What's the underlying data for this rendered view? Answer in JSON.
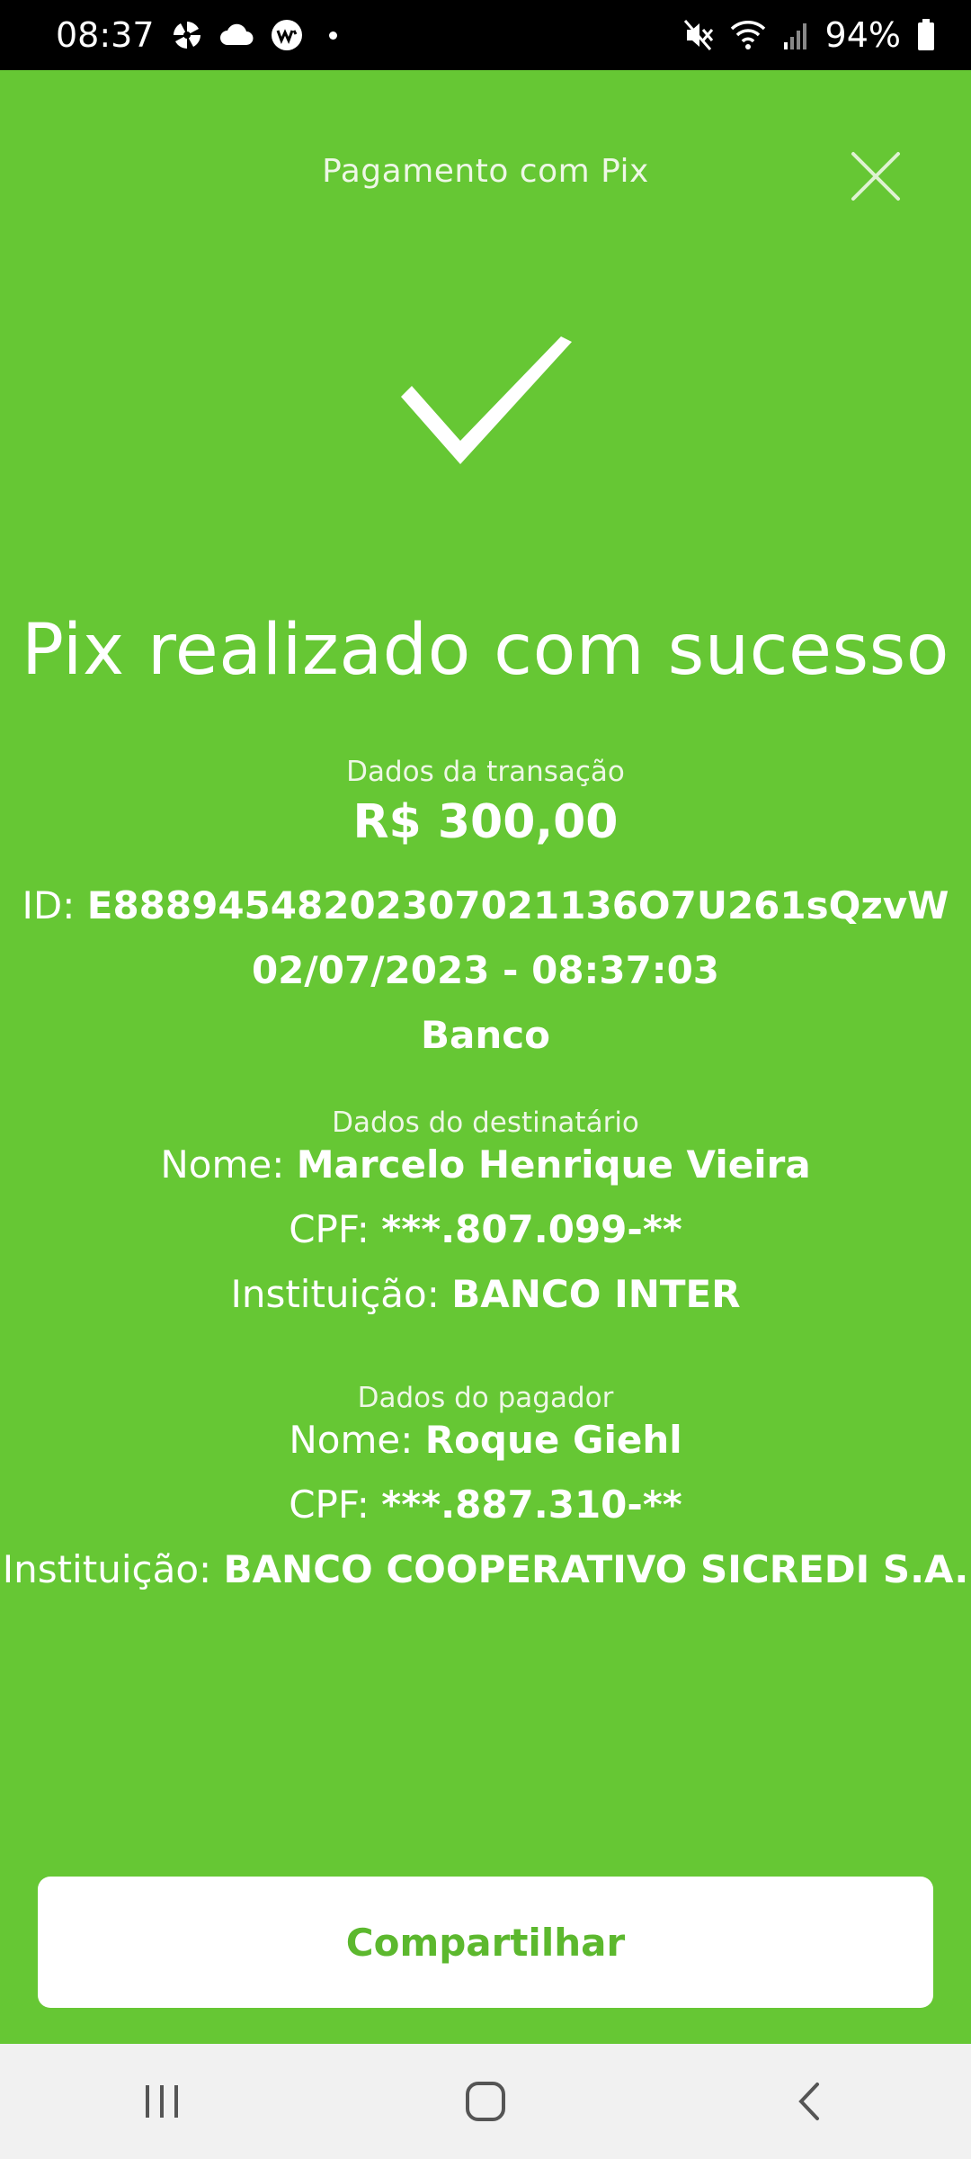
{
  "status_bar": {
    "time": "08:37",
    "battery": "94%",
    "icons": [
      "pinwheel-icon",
      "cloud-icon",
      "w-circle-icon",
      "dot-icon",
      "mute-icon",
      "wifi-icon",
      "signal-icon",
      "battery-icon"
    ]
  },
  "header": {
    "title": "Pagamento com Pix",
    "close_icon": "close-icon"
  },
  "success": {
    "icon": "checkmark-icon",
    "title": "Pix realizado com sucesso"
  },
  "transaction": {
    "section_label": "Dados da transação",
    "amount": "R$ 300,00",
    "id_label": "ID:",
    "id_value": "E88894548202307021136O7U261sQzvW",
    "datetime": "02/07/2023 - 08:37:03",
    "type": "Banco"
  },
  "recipient": {
    "section_label": "Dados do destinatário",
    "name_label": "Nome:",
    "name_value": "Marcelo Henrique Vieira",
    "cpf_label": "CPF:",
    "cpf_value": "***.807.099-**",
    "institution_label": "Instituição:",
    "institution_value": "BANCO INTER"
  },
  "payer": {
    "section_label": "Dados do pagador",
    "name_label": "Nome:",
    "name_value": "Roque Giehl",
    "cpf_label": "CPF:",
    "cpf_value": "***.887.310-**",
    "institution_label": "Instituição:",
    "institution_value": "BANCO COOPERATIVO SICREDI S.A."
  },
  "actions": {
    "share_label": "Compartilhar"
  },
  "colors": {
    "background": "#66c734",
    "button_text": "#5cb82e"
  }
}
